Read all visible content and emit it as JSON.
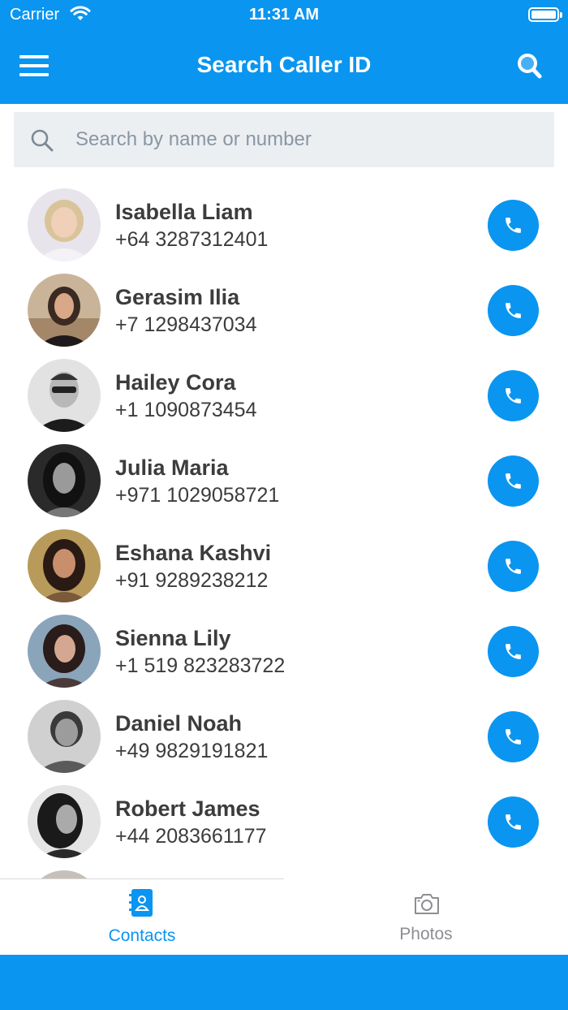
{
  "status_bar": {
    "carrier": "Carrier",
    "time": "11:31 AM"
  },
  "nav": {
    "title": "Search Caller ID",
    "menu_icon": "hamburger-menu-icon",
    "search_icon": "magnifier-icon"
  },
  "search": {
    "placeholder": "Search by name or number",
    "value": ""
  },
  "contacts": [
    {
      "name": "Isabella Liam",
      "phone": "+64 3287312401"
    },
    {
      "name": "Gerasim Ilia",
      "phone": "+7 1298437034"
    },
    {
      "name": "Hailey Cora",
      "phone": "+1 1090873454"
    },
    {
      "name": "Julia Maria",
      "phone": "+971 1029058721"
    },
    {
      "name": "Eshana Kashvi",
      "phone": "+91 9289238212"
    },
    {
      "name": "Sienna Lily",
      "phone": "+1 519 823283722"
    },
    {
      "name": "Daniel Noah",
      "phone": "+49 9829191821"
    },
    {
      "name": "Robert James",
      "phone": "+44 2083661177"
    }
  ],
  "tabs": [
    {
      "label": "Contacts",
      "icon": "address-book-icon",
      "selected": true
    },
    {
      "label": "Photos",
      "icon": "camera-icon",
      "selected": false
    }
  ],
  "colors": {
    "accent": "#0a95f0",
    "search_bg": "#eceff2",
    "text": "#3c3c3c",
    "inactive_tab": "#8e8e93"
  }
}
